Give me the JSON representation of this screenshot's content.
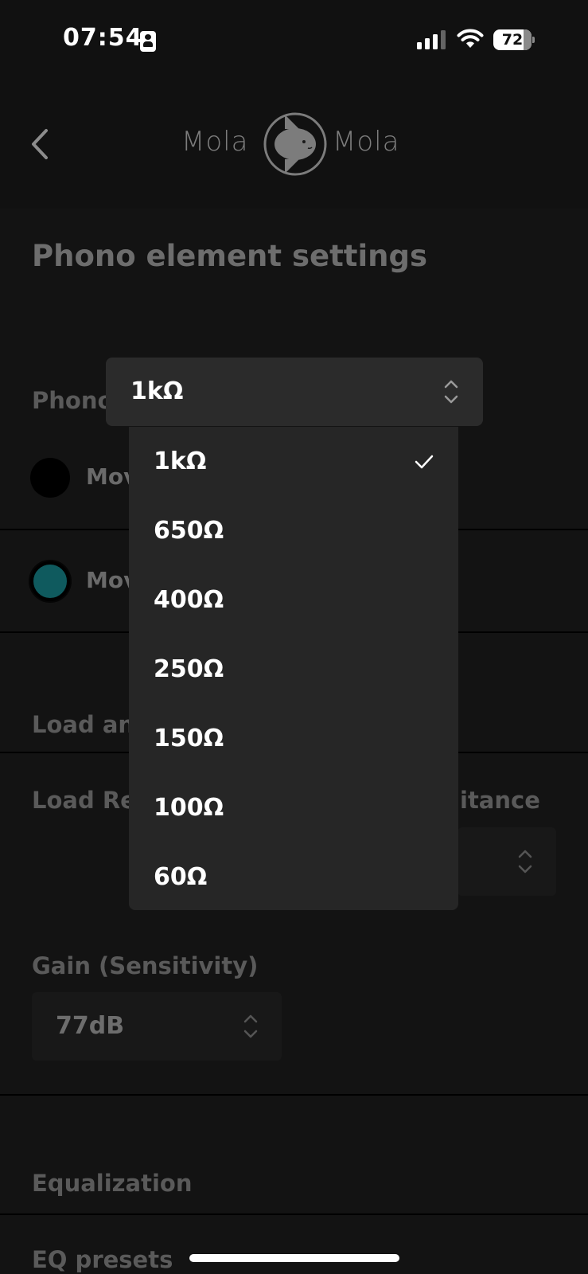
{
  "status_bar": {
    "time": "07:54",
    "battery_level": "72",
    "icons": [
      "id-card-icon",
      "cellular-signal-icon",
      "wifi-icon",
      "battery-icon"
    ]
  },
  "header": {
    "back_icon": "chevron-left-icon",
    "logo_word_left": "Mola",
    "logo_word_right": "Mola",
    "logo_icon": "sunfish-logo-icon"
  },
  "page": {
    "title": "Phono element settings",
    "phono_section": {
      "label_visible": "Phono",
      "options": [
        {
          "label_visible": "Mov",
          "selected": false
        },
        {
          "label_visible": "Mov",
          "selected": true
        }
      ]
    },
    "load_section": {
      "heading_visible": "Load an",
      "resistance_label_visible": "Load Re",
      "capacitance_label_visible": "itance"
    },
    "gain": {
      "label": "Gain (Sensitivity)",
      "value": "77dB"
    },
    "equalization": {
      "heading": "Equalization",
      "presets_label": "EQ presets"
    }
  },
  "select": {
    "value": "1kΩ",
    "options": [
      "1kΩ",
      "650Ω",
      "400Ω",
      "250Ω",
      "150Ω",
      "100Ω",
      "60Ω"
    ],
    "selected_index": 0
  },
  "colors": {
    "background": "#111111",
    "menu": "#262626",
    "select_box": "#2b2b2b",
    "accent_teal": "#0f5a5e",
    "dim_text": "#6a6a6a"
  }
}
